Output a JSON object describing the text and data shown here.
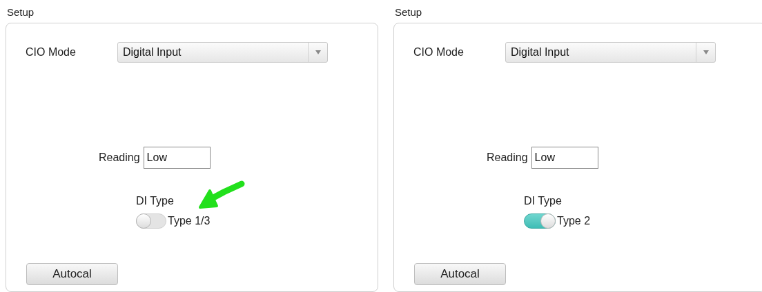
{
  "panels": [
    {
      "title": "Setup",
      "cio_mode": {
        "label": "CIO Mode",
        "value": "Digital Input"
      },
      "reading": {
        "label": "Reading",
        "value": "Low"
      },
      "di_type": {
        "label": "DI Type",
        "on": false,
        "option": "Type 1/3"
      },
      "button": "Autocal",
      "annotation": true
    },
    {
      "title": "Setup",
      "cio_mode": {
        "label": "CIO Mode",
        "value": "Digital Input"
      },
      "reading": {
        "label": "Reading",
        "value": "Low"
      },
      "di_type": {
        "label": "DI Type",
        "on": true,
        "option": "Type 2"
      },
      "button": "Autocal",
      "annotation": false
    }
  ]
}
